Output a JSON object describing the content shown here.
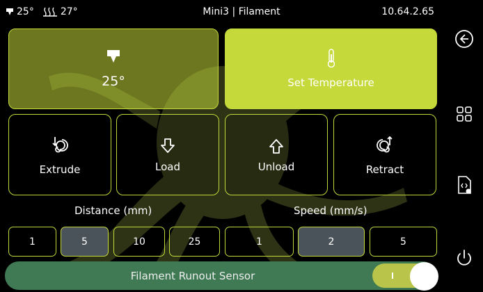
{
  "status": {
    "nozzle_temp": "25°",
    "bed_temp": "27°",
    "title": "Mini3 | Filament",
    "ip": "10.64.2.65"
  },
  "temp_card": {
    "value": "25°",
    "icon": "nozzle-icon"
  },
  "set_temperature": {
    "label": "Set Temperature",
    "icon": "thermometer-icon"
  },
  "actions": [
    {
      "label": "Extrude",
      "icon": "extrude-icon"
    },
    {
      "label": "Load",
      "icon": "arrow-down-icon"
    },
    {
      "label": "Unload",
      "icon": "arrow-up-icon"
    },
    {
      "label": "Retract",
      "icon": "retract-icon"
    }
  ],
  "distance": {
    "label": "Distance (mm)",
    "options": [
      "1",
      "5",
      "10",
      "25"
    ],
    "selected": "5"
  },
  "speed": {
    "label": "Speed (mm/s)",
    "options": [
      "1",
      "2",
      "5"
    ],
    "selected": "2"
  },
  "sensor": {
    "label": "Filament Runout Sensor",
    "enabled": true
  },
  "sidebar": [
    "back-icon",
    "grid-icon",
    "file-code-icon",
    "power-icon"
  ],
  "colors": {
    "accent": "#c5d93a",
    "selected_option": "#4a535a",
    "sensor_bar": "#3f7a55",
    "background": "#000000"
  }
}
